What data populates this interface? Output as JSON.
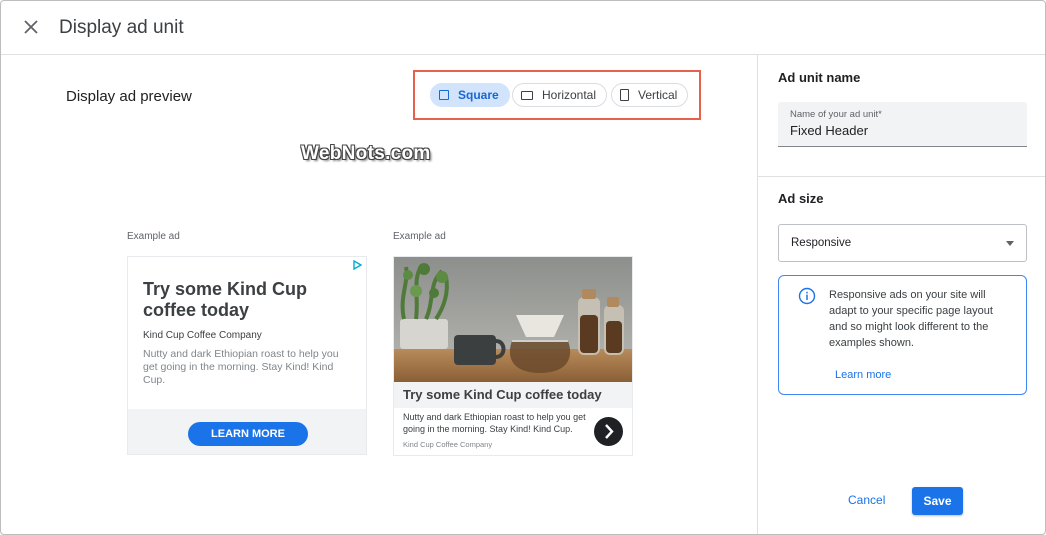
{
  "dialog": {
    "title": "Display ad unit"
  },
  "preview": {
    "title": "Display ad preview",
    "tabs": [
      {
        "label": "Square",
        "selected": true
      },
      {
        "label": "Horizontal",
        "selected": false
      },
      {
        "label": "Vertical",
        "selected": false
      }
    ],
    "watermark": "WebNots.com",
    "example_label": "Example ad",
    "ad_square": {
      "headline": "Try some Kind Cup coffee today",
      "company": "Kind Cup Coffee Company",
      "description": "Nutty and dark Ethiopian roast to help you get going in the morning. Stay Kind! Kind Cup.",
      "cta": "LEARN MORE"
    },
    "ad_image": {
      "headline": "Try some Kind Cup coffee today",
      "description": "Nutty and dark Ethiopian roast to help you get going in the morning. Stay Kind! Kind Cup.",
      "company": "Kind Cup Coffee Company"
    }
  },
  "sidebar": {
    "ad_unit_name_heading": "Ad unit name",
    "name_field": {
      "label": "Name of your ad unit*",
      "value": "Fixed Header"
    },
    "ad_size_heading": "Ad size",
    "ad_size_value": "Responsive",
    "info_text": "Responsive ads on your site will adapt to your specific page layout and so might look different to the examples shown.",
    "learn_more": "Learn more",
    "cancel_label": "Cancel",
    "save_label": "Save"
  },
  "colors": {
    "accent": "#1a73e8",
    "selected_chip": "#d2e3fc",
    "highlight_annotation": "#e8604c"
  }
}
